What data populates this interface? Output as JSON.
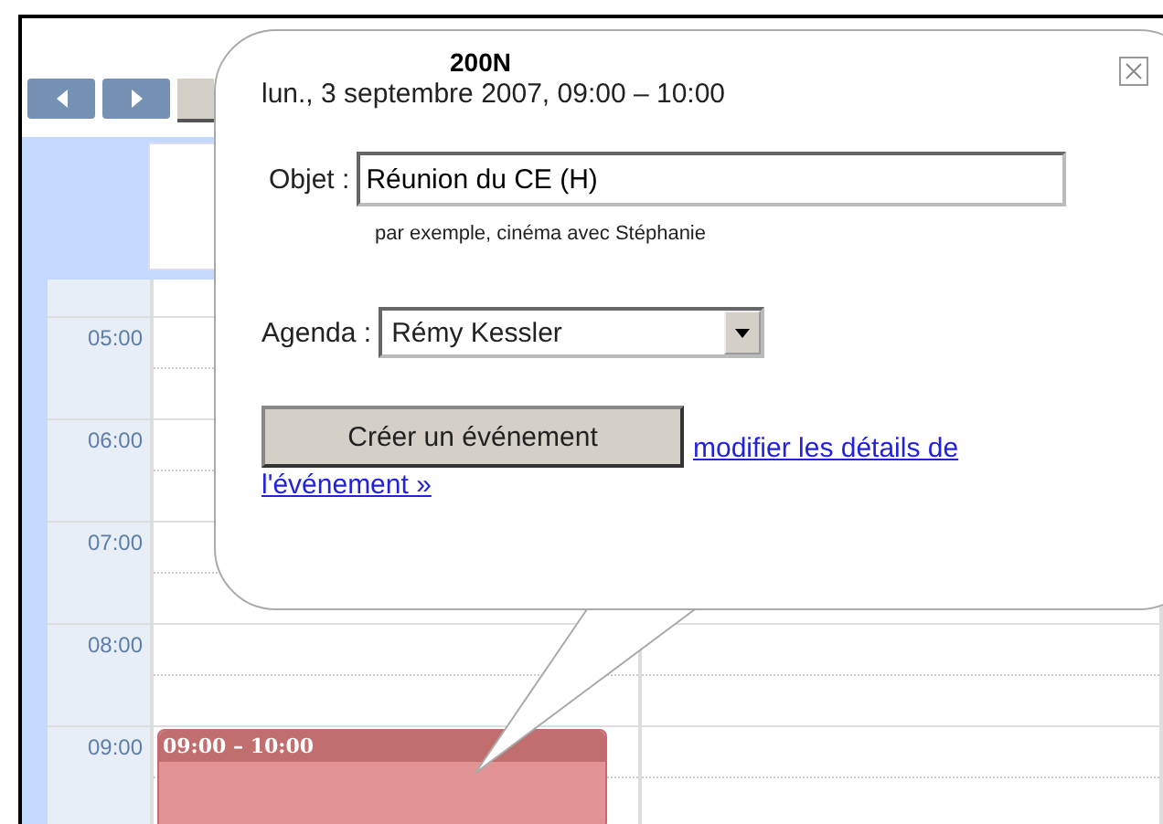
{
  "calendar": {
    "hours": [
      "05:00",
      "06:00",
      "07:00",
      "08:00",
      "09:00"
    ],
    "event": {
      "time": "09:00 – 10:00",
      "color": "#e29494"
    }
  },
  "popup": {
    "date": "lun., 3 septembre 2007, 09:00 – 10:00",
    "overlay_text": "200N",
    "subject": {
      "label": "Objet :",
      "value": "Réunion du CE (H)",
      "hint": "par exemple, cinéma avec Stéphanie"
    },
    "calendar_field": {
      "label": "Agenda :",
      "value": "Rémy Kessler"
    },
    "create_button": "Créer un événement",
    "details_link": [
      "modifier les détails de",
      "l'événement »"
    ]
  }
}
